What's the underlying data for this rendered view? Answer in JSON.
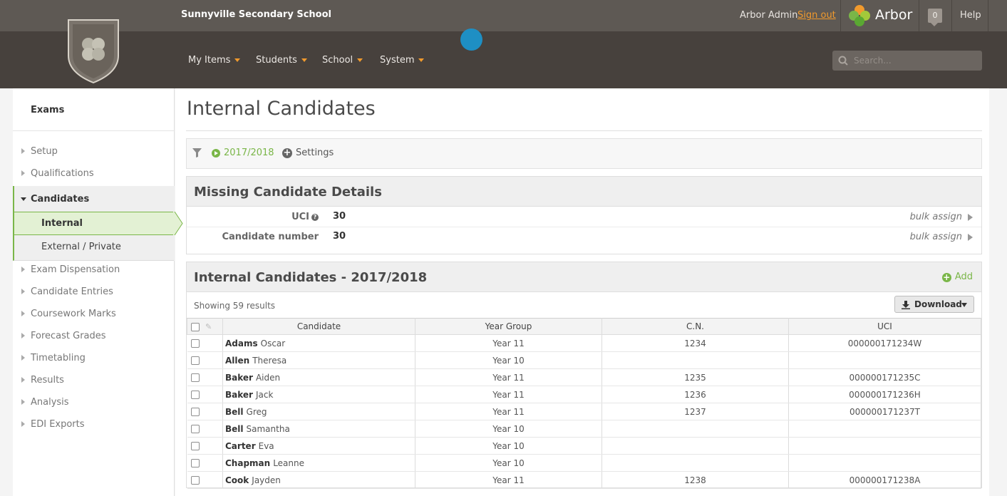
{
  "header": {
    "school_name": "Sunnyville Secondary School",
    "user_name": "Arbor Admin",
    "sign_out": "Sign out",
    "brand": "Arbor",
    "notification_count": "0",
    "help": "Help",
    "accent_color": "#f19a2d"
  },
  "nav": {
    "items": [
      {
        "label": "My Items"
      },
      {
        "label": "Students"
      },
      {
        "label": "School"
      },
      {
        "label": "System"
      }
    ],
    "search_placeholder": "Search..."
  },
  "sidebar": {
    "title": "Exams",
    "items_top": [
      {
        "label": "Setup"
      },
      {
        "label": "Qualifications"
      }
    ],
    "candidates": {
      "label": "Candidates",
      "children": [
        {
          "label": "Internal",
          "active": true
        },
        {
          "label": "External / Private"
        }
      ]
    },
    "items_bottom": [
      {
        "label": "Exam Dispensation"
      },
      {
        "label": "Candidate Entries"
      },
      {
        "label": "Coursework Marks"
      },
      {
        "label": "Forecast Grades"
      },
      {
        "label": "Timetabling"
      },
      {
        "label": "Results"
      },
      {
        "label": "Analysis"
      },
      {
        "label": "EDI Exports"
      }
    ],
    "active_color": "#7ab648"
  },
  "page": {
    "title": "Internal Candidates",
    "filter": {
      "year": "2017/2018",
      "settings": "Settings"
    },
    "missing_details": {
      "title": "Missing Candidate Details",
      "rows": [
        {
          "label": "UCI",
          "value": "30",
          "action": "bulk assign"
        },
        {
          "label": "Candidate number",
          "value": "30",
          "action": "bulk assign"
        }
      ]
    },
    "candidates_panel": {
      "title": "Internal Candidates - 2017/2018",
      "add_label": "Add",
      "showing": "Showing 59 results",
      "download_label": "Download",
      "columns": [
        "Candidate",
        "Year Group",
        "C.N.",
        "UCI"
      ],
      "rows": [
        {
          "last": "Adams",
          "first": "Oscar",
          "year": "Year 11",
          "cn": "1234",
          "uci": "000000171234W"
        },
        {
          "last": "Allen",
          "first": "Theresa",
          "year": "Year 10",
          "cn": "",
          "uci": ""
        },
        {
          "last": "Baker",
          "first": "Aiden",
          "year": "Year 11",
          "cn": "1235",
          "uci": "000000171235C"
        },
        {
          "last": "Baker",
          "first": "Jack",
          "year": "Year 11",
          "cn": "1236",
          "uci": "000000171236H"
        },
        {
          "last": "Bell",
          "first": "Greg",
          "year": "Year 11",
          "cn": "1237",
          "uci": "000000171237T"
        },
        {
          "last": "Bell",
          "first": "Samantha",
          "year": "Year 10",
          "cn": "",
          "uci": ""
        },
        {
          "last": "Carter",
          "first": "Eva",
          "year": "Year 10",
          "cn": "",
          "uci": ""
        },
        {
          "last": "Chapman",
          "first": "Leanne",
          "year": "Year 10",
          "cn": "",
          "uci": ""
        },
        {
          "last": "Cook",
          "first": "Jayden",
          "year": "Year 11",
          "cn": "1238",
          "uci": "000000171238A"
        }
      ]
    }
  }
}
